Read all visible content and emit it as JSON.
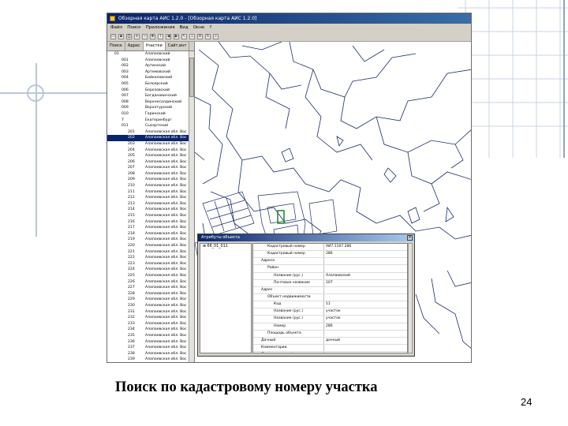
{
  "window": {
    "title": "Обзорная карта АИС 1.2.0 - [Обзорная карта АИС 1.2.0]",
    "menu": [
      "Файл",
      "Поиск",
      "Приложения",
      "Вид",
      "Окно",
      "?"
    ]
  },
  "toolbar": {
    "icons": [
      "open-icon",
      "save-icon",
      "print-icon",
      "zoom-in-icon",
      "zoom-out-icon",
      "pan-icon",
      "info-icon",
      "back-icon",
      "forward-icon",
      "select-icon",
      "measure-icon",
      "layers-icon",
      "refresh-icon",
      "search-icon"
    ]
  },
  "left_panel": {
    "tabs": [
      "Поиск",
      "Адрес",
      "Участки",
      "Сайт.инт"
    ],
    "active_tab": 2,
    "rows": [
      {
        "code": "01",
        "name": "Алапаевский",
        "level": 0
      },
      {
        "code": "001",
        "name": "Алапаевский",
        "level": 1
      },
      {
        "code": "002",
        "name": "Артинский",
        "level": 1
      },
      {
        "code": "003",
        "name": "Артемовский",
        "level": 1
      },
      {
        "code": "004",
        "name": "Байкаловский",
        "level": 1
      },
      {
        "code": "005",
        "name": "Белоярский",
        "level": 1
      },
      {
        "code": "006",
        "name": "Березовский",
        "level": 1
      },
      {
        "code": "007",
        "name": "Богдановичский",
        "level": 1
      },
      {
        "code": "008",
        "name": "Верхнесалдинский",
        "level": 1
      },
      {
        "code": "009",
        "name": "Верхотурский",
        "level": 1
      },
      {
        "code": "010",
        "name": "Гаринский",
        "level": 1
      },
      {
        "code": "7",
        "name": "Екатеринбург",
        "level": 1
      },
      {
        "code": "011",
        "name": "Сысертский",
        "level": 1
      },
      {
        "code": "201",
        "name": "Алапаевская обл. Вос",
        "level": 2
      },
      {
        "code": "202",
        "name": "Алапаевская обл. Вос",
        "level": 2,
        "selected": true
      },
      {
        "code": "203",
        "name": "Алапаевская обл. Вос",
        "level": 2
      },
      {
        "code": "204",
        "name": "Алапаевская обл. Вос",
        "level": 2
      },
      {
        "code": "205",
        "name": "Алапаевская обл. Вос",
        "level": 2
      },
      {
        "code": "206",
        "name": "Алапаевская обл. Вос",
        "level": 2
      },
      {
        "code": "207",
        "name": "Алапаевская обл. Вос",
        "level": 2
      },
      {
        "code": "208",
        "name": "Алапаевская обл. Вос",
        "level": 2
      },
      {
        "code": "209",
        "name": "Алапаевская обл. Вос",
        "level": 2
      },
      {
        "code": "210",
        "name": "Алапаевская обл. Вос",
        "level": 2
      },
      {
        "code": "211",
        "name": "Алапаевская обл. Вос",
        "level": 2
      },
      {
        "code": "212",
        "name": "Алапаевская обл. Вос",
        "level": 2
      },
      {
        "code": "213",
        "name": "Алапаевская обл. Вос",
        "level": 2
      },
      {
        "code": "214",
        "name": "Алапаевская обл. Вос",
        "level": 2
      },
      {
        "code": "215",
        "name": "Алапаевская обл. Вос",
        "level": 2
      },
      {
        "code": "216",
        "name": "Алапаевская обл. Вос",
        "level": 2
      },
      {
        "code": "217",
        "name": "Алапаевская обл. Вос",
        "level": 2
      },
      {
        "code": "218",
        "name": "Алапаевская обл. Вос",
        "level": 2
      },
      {
        "code": "219",
        "name": "Алапаевская обл. Вос",
        "level": 2
      },
      {
        "code": "220",
        "name": "Алапаевская обл. Вос",
        "level": 2
      },
      {
        "code": "221",
        "name": "Алапаевская обл. Вос",
        "level": 2
      },
      {
        "code": "222",
        "name": "Алапаевская обл. Вос",
        "level": 2
      },
      {
        "code": "223",
        "name": "Алапаевская обл. Вос",
        "level": 2
      },
      {
        "code": "224",
        "name": "Алапаевская обл. Вос",
        "level": 2
      },
      {
        "code": "225",
        "name": "Алапаевская обл. Вос",
        "level": 2
      },
      {
        "code": "226",
        "name": "Алапаевская обл. Вос",
        "level": 2
      },
      {
        "code": "227",
        "name": "Алапаевская обл. Вос",
        "level": 2
      },
      {
        "code": "228",
        "name": "Алапаевская обл. Вос",
        "level": 2
      },
      {
        "code": "229",
        "name": "Алапаевская обл. Вос",
        "level": 2
      },
      {
        "code": "230",
        "name": "Алапаевская обл. Вос",
        "level": 2
      },
      {
        "code": "231",
        "name": "Алапаевская обл. Вос",
        "level": 2
      },
      {
        "code": "232",
        "name": "Алапаевская обл. Вос",
        "level": 2
      },
      {
        "code": "233",
        "name": "Алапаевская обл. Вос",
        "level": 2
      },
      {
        "code": "234",
        "name": "Алапаевская обл. Вос",
        "level": 2
      },
      {
        "code": "235",
        "name": "Алапаевская обл. Вос",
        "level": 2
      },
      {
        "code": "236",
        "name": "Алапаевская обл. Вос",
        "level": 2
      },
      {
        "code": "237",
        "name": "Алапаевская обл. Вос",
        "level": 2
      },
      {
        "code": "238",
        "name": "Алапаевская обл. Вос",
        "level": 2
      },
      {
        "code": "239",
        "name": "Алапаевская обл. Вос",
        "level": 2
      },
      {
        "code": "240",
        "name": "Алапаевская обл. Вос",
        "level": 2
      }
    ]
  },
  "popup": {
    "title": "Атрибуты объекта",
    "close_label": "×",
    "tree_node": "66_01_011",
    "rows": [
      {
        "key": "Кадастровый номер",
        "value": "АИ7.1107.286",
        "level": 2
      },
      {
        "key": "Кадастровый номер",
        "value": "286",
        "level": 2
      },
      {
        "key": "Адреса",
        "value": "",
        "level": 1
      },
      {
        "key": "Район",
        "value": "",
        "level": 2
      },
      {
        "key": "Название (рус.)",
        "value": "Алапаевский",
        "level": 3
      },
      {
        "key": "Почтовое название",
        "value": "107",
        "level": 3
      },
      {
        "key": "Адрес",
        "value": "",
        "level": 1
      },
      {
        "key": "Объект недвижимости",
        "value": "",
        "level": 2
      },
      {
        "key": "Код",
        "value": "11",
        "level": 3
      },
      {
        "key": "Название (рус.)",
        "value": "участок",
        "level": 3
      },
      {
        "key": "Название (рус.)",
        "value": "участок",
        "level": 3
      },
      {
        "key": "Номер",
        "value": "286",
        "level": 3
      },
      {
        "key": "Площадь объекта",
        "value": "",
        "level": 2
      },
      {
        "key": "Дачный",
        "value": "дачный",
        "level": 1
      },
      {
        "key": "Комментарии",
        "value": "",
        "level": 1
      },
      {
        "key": "Дополнительный адрес",
        "value": "",
        "level": 1
      },
      {
        "key": "Правообладатель",
        "value": "",
        "level": 1
      }
    ]
  },
  "slide": {
    "caption": "Поиск по кадастровому номеру участка",
    "page_number": "24"
  },
  "colors": {
    "titlebar": "#0a246a",
    "selection": "#0a246a",
    "map_lines": "#1a2c6e",
    "highlight": "#2a8a2a"
  }
}
